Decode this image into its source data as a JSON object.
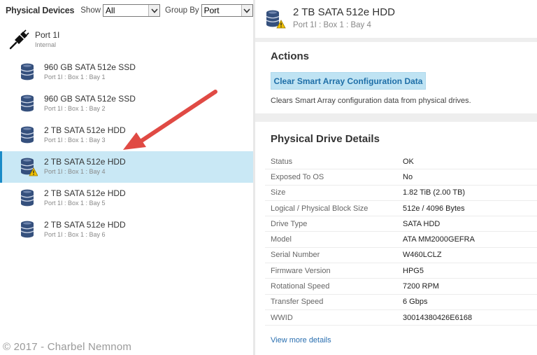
{
  "left_panel": {
    "title": "Physical Devices",
    "show_label": "Show",
    "show_value": "All",
    "group_by_label": "Group By",
    "group_by_value": "Port",
    "port": {
      "name": "Port 1I",
      "subtitle": "Internal"
    },
    "drives": [
      {
        "name": "960 GB SATA 512e SSD",
        "location": "Port 1I : Box 1 : Bay 1",
        "selected": false,
        "warning": false
      },
      {
        "name": "960 GB SATA 512e SSD",
        "location": "Port 1I : Box 1 : Bay 2",
        "selected": false,
        "warning": false
      },
      {
        "name": "2 TB SATA 512e HDD",
        "location": "Port 1I : Box 1 : Bay 3",
        "selected": false,
        "warning": false
      },
      {
        "name": "2 TB SATA 512e HDD",
        "location": "Port 1I : Box 1 : Bay 4",
        "selected": true,
        "warning": true
      },
      {
        "name": "2 TB SATA 512e HDD",
        "location": "Port 1I : Box 1 : Bay 5",
        "selected": false,
        "warning": false
      },
      {
        "name": "2 TB SATA 512e HDD",
        "location": "Port 1I : Box 1 : Bay 6",
        "selected": false,
        "warning": false
      }
    ]
  },
  "right_panel": {
    "title": "2 TB SATA 512e HDD",
    "subtitle": "Port 1I : Box 1 : Bay 4",
    "actions_title": "Actions",
    "action_button": "Clear Smart Array Configuration Data",
    "action_description": "Clears Smart Array configuration data from physical drives.",
    "details_title": "Physical Drive Details",
    "details": [
      {
        "key": "Status",
        "value": "OK"
      },
      {
        "key": "Exposed To OS",
        "value": "No"
      },
      {
        "key": "Size",
        "value": "1.82 TiB (2.00 TB)"
      },
      {
        "key": "Logical / Physical Block Size",
        "value": "512e / 4096 Bytes"
      },
      {
        "key": "Drive Type",
        "value": "SATA HDD"
      },
      {
        "key": "Model",
        "value": "ATA MM2000GEFRA"
      },
      {
        "key": "Serial Number",
        "value": "W460LCLZ"
      },
      {
        "key": "Firmware Version",
        "value": "HPG5"
      },
      {
        "key": "Rotational Speed",
        "value": "7200 RPM"
      },
      {
        "key": "Transfer Speed",
        "value": "6 Gbps"
      },
      {
        "key": "WWID",
        "value": "30014380426E6168"
      }
    ],
    "view_more": "View more details"
  },
  "watermark": "© 2017 - Charbel Nemnom",
  "colors": {
    "selected_bg": "#c9e8f5",
    "selected_border": "#1a8bc7",
    "action_button_bg": "#bfe3f3",
    "action_button_text": "#1f6fa8",
    "link": "#2a6fb0",
    "arrow": "#e04a44",
    "drive_icon": "#35507d",
    "warning": "#f2c200"
  },
  "icons": {
    "port": "cable-connector-icon",
    "drive": "drive-stack-icon",
    "warning": "warning-triangle-icon",
    "dropdown": "chevron-down-icon"
  }
}
